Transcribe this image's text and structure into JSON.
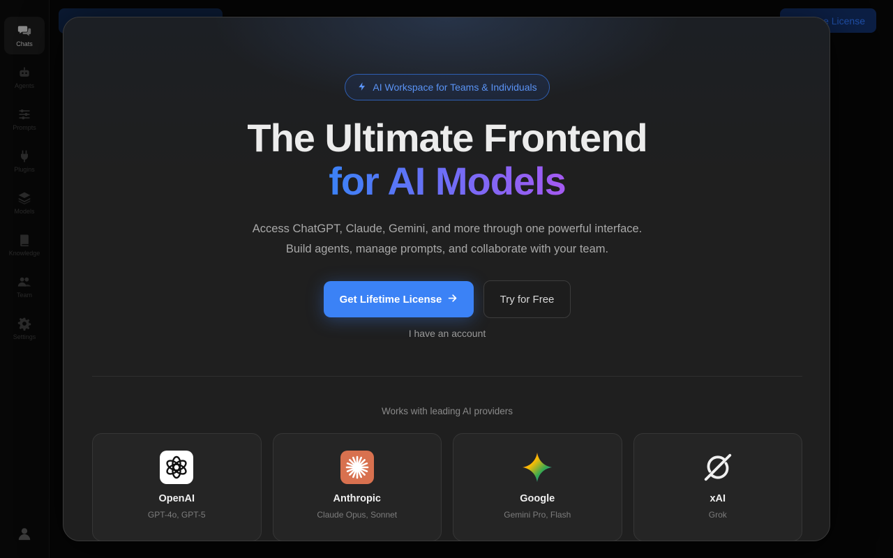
{
  "sidebar": {
    "items": [
      {
        "label": "Chats",
        "icon": "chat-icon",
        "active": true
      },
      {
        "label": "Agents",
        "icon": "robot-icon"
      },
      {
        "label": "Prompts",
        "icon": "sliders-icon"
      },
      {
        "label": "Plugins",
        "icon": "plug-icon"
      },
      {
        "label": "Models",
        "icon": "layers-icon"
      },
      {
        "label": "Knowledge",
        "icon": "book-icon"
      },
      {
        "label": "Team",
        "icon": "team-icon"
      },
      {
        "label": "Settings",
        "icon": "gear-icon"
      }
    ],
    "user_icon": "user-icon"
  },
  "background": {
    "top_right_button": "Lifetime License"
  },
  "modal": {
    "badge": "AI Workspace for Teams & Individuals",
    "headline_line1": "The Ultimate Frontend",
    "headline_line2": "for AI Models",
    "subtitle_line1": "Access ChatGPT, Claude, Gemini, and more through one powerful interface.",
    "subtitle_line2": "Build agents, manage prompts, and collaborate with your team.",
    "primary_button": "Get Lifetime License",
    "secondary_button": "Try for Free",
    "account_link": "I have an account",
    "providers_heading": "Works with leading AI providers",
    "providers": [
      {
        "name": "OpenAI",
        "models": "GPT-4o, GPT-5",
        "icon": "openai-logo-icon"
      },
      {
        "name": "Anthropic",
        "models": "Claude Opus, Sonnet",
        "icon": "anthropic-logo-icon"
      },
      {
        "name": "Google",
        "models": "Gemini Pro, Flash",
        "icon": "gemini-logo-icon"
      },
      {
        "name": "xAI",
        "models": "Grok",
        "icon": "xai-logo-icon"
      }
    ]
  },
  "colors": {
    "accent": "#3b82f6",
    "gradient_start": "#3b82f6",
    "gradient_end": "#a55af2",
    "modal_bg": "#1f1f1f"
  }
}
